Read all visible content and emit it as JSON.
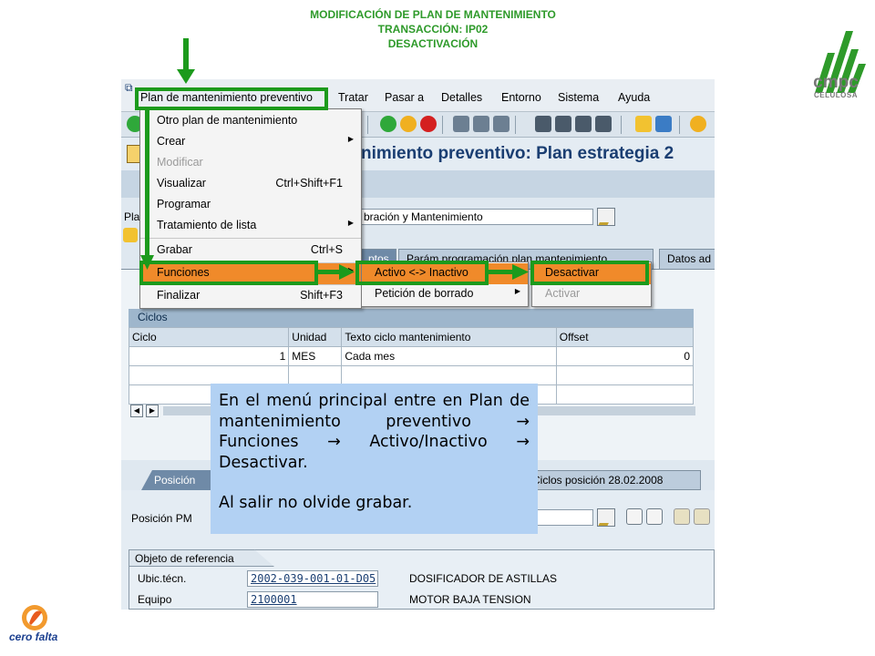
{
  "slide": {
    "title_lines": [
      "MODIFICACIÓN DE PLAN DE MANTENIMIENTO",
      "TRANSACCIÓN: IP02",
      "DESACTIVACIÓN"
    ],
    "logo_brand": "cmpc",
    "logo_sub": "CELULOSA",
    "footer_logo_text": "cero falta"
  },
  "menubar": {
    "items": [
      "Plan de mantenimiento preventivo",
      "Tratar",
      "Pasar a",
      "Detalles",
      "Entorno",
      "Sistema",
      "Ayuda"
    ]
  },
  "sap": {
    "title": "nimiento preventivo: Plan estrategia 2",
    "plan_label": "Pla",
    "plan_text": "bración y Mantenimiento",
    "tabs": [
      "ptos",
      "Parám.programación plan mantenimiento",
      "Datos ad"
    ],
    "ciclos_header": "Ciclos",
    "grid": {
      "columns": [
        "Ciclo",
        "Unidad",
        "Texto ciclo mantenimiento",
        "Offset"
      ],
      "rows": [
        [
          "1",
          "MES",
          "Cada mes",
          "0"
        ],
        [
          "",
          "",
          "",
          ""
        ],
        [
          "",
          "",
          "",
          ""
        ]
      ]
    },
    "pos_tabs": [
      "Posición",
      "Ciclos posición 28.02.2008"
    ],
    "pos_label": "Posición PM",
    "ref_title": "Objeto de referencia",
    "ref_rows": [
      {
        "label": "Ubic.técn.",
        "value": "2002-039-001-01-D05",
        "desc": "DOSIFICADOR DE ASTILLAS"
      },
      {
        "label": "Equipo",
        "value": "2100001",
        "desc": "MOTOR BAJA TENSION"
      }
    ]
  },
  "menu_main": {
    "items": [
      {
        "label": "Otro plan de mantenimiento",
        "accel": "",
        "submenu": false,
        "disabled": false
      },
      {
        "label": "Crear",
        "accel": "",
        "submenu": true,
        "disabled": false
      },
      {
        "label": "Modificar",
        "accel": "",
        "submenu": false,
        "disabled": true
      },
      {
        "label": "Visualizar",
        "accel": "Ctrl+Shift+F1",
        "submenu": false,
        "disabled": false
      },
      {
        "label": "Programar",
        "accel": "",
        "submenu": false,
        "disabled": false
      },
      {
        "label": "Tratamiento de lista",
        "accel": "",
        "submenu": true,
        "disabled": false
      },
      {
        "label": "Grabar",
        "accel": "Ctrl+S",
        "submenu": false,
        "disabled": false
      },
      {
        "label": "Funciones",
        "accel": "",
        "submenu": true,
        "disabled": false
      },
      {
        "label": "Finalizar",
        "accel": "Shift+F3",
        "submenu": false,
        "disabled": false
      }
    ]
  },
  "menu_funciones": {
    "items": [
      {
        "label": "Activo <-> Inactivo",
        "submenu": true
      },
      {
        "label": "Petición de borrado",
        "submenu": true
      }
    ]
  },
  "menu_activo": {
    "items": [
      {
        "label": "Desactivar",
        "disabled": false
      },
      {
        "label": "Activar",
        "disabled": true
      }
    ]
  },
  "callout": {
    "text": "En el menú principal entre en Plan de mantenimiento preventivo  Funciones  Activo/Inactivo  Desactivar.",
    "note": "Al salir no olvide grabar."
  },
  "colors": {
    "title_green": "#2e9a2a",
    "highlight_orange": "#f08a2a",
    "annotation_green": "#1c9a1c",
    "callout_blue": "#b2d1f3"
  }
}
